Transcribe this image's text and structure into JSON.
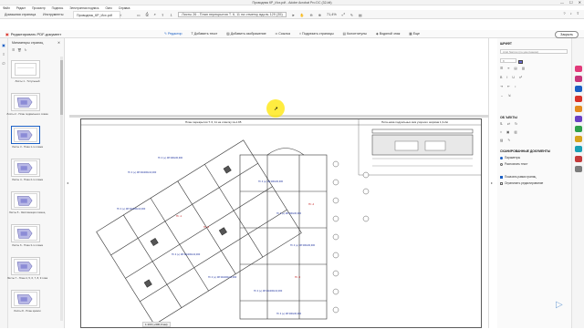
{
  "window": {
    "title": "Проводник КР_Исх.pdf - Adobe Acrobat Pro DC (32-bit)",
    "controls": [
      "—",
      "☐",
      "✕"
    ]
  },
  "menu": [
    "Файл",
    "Редакт",
    "Просмотр",
    "Подпись",
    "Электронная подпись",
    "Окно",
    "Справка"
  ],
  "tabs": [
    {
      "label": "Домашняя страница",
      "active": false
    },
    {
      "label": "Инструменты",
      "active": false
    },
    {
      "label": "Проводник_КР_Исх.pdf",
      "active": true,
      "close": "✕"
    }
  ],
  "toolbar": {
    "page_field": "Листы 26 - План перекрытия Т. 6, 11 на отметку вдоль 129 (35)",
    "zoom": "71,4%",
    "icons": [
      "save-icon",
      "print-icon",
      "search-icon",
      "zoom-out-icon",
      "zoom-in-icon",
      "select-icon",
      "hand-icon"
    ]
  },
  "editbar": {
    "label": "Редактировать PDF-документ",
    "tools": [
      {
        "label": "Редактир",
        "primary": true
      },
      {
        "label": "Добавить текст"
      },
      {
        "label": "Добавить изображение"
      },
      {
        "label": "Ссылка"
      },
      {
        "label": "Подрезать страницы"
      },
      {
        "label": "Колонтитулы"
      },
      {
        "label": "Водяной знак"
      },
      {
        "label": "Еще"
      }
    ],
    "close_label": "Закрыть"
  },
  "thumbnails": {
    "title": "Миниатюры страниц",
    "items": [
      "Листы 1 - Титульный",
      "Листы 2 - План подвального этажа",
      "Листы 3 - План 1-го этажа",
      "Листы 4 - План 2-го этажа",
      "Листы 5 - Экспликация помещ.",
      "Листы 6 - План 3-го этажа",
      "Листы 7 - План 4, 5, 6, 7, 8, 9 этаж",
      "Листы 8 - План кровли"
    ]
  },
  "drawing": {
    "left_title": "План перекрытия Т. 6, 11 на отметку Н+1.95",
    "right_title": "Пита-нова подрильных ёмк узорного ширима 1,3-2м",
    "bottom_label": "1:100 (+300,0 мм)"
  },
  "rightpanel": {
    "font_section": "ШРИФТ",
    "font_value": "Arial Narrow (по-умолчанию)",
    "size_value": "8",
    "objects_section": "ОБ ЪЕКТЫ",
    "scan_section": "СКАНИРОВАННЫЕ ДОКУМЕНТЫ",
    "scan_options": [
      {
        "label": "Параметры",
        "on": true
      },
      {
        "label": "Распознать текст",
        "on": false
      }
    ],
    "checkbox_options": [
      {
        "label": "Показать рамки границ",
        "on": true
      },
      {
        "label": "Ограничить редактирование",
        "on": false
      }
    ]
  },
  "toolrail_colors": [
    "#e23a7a",
    "#c8357a",
    "#1a5fc4",
    "#d9322a",
    "#e48a1e",
    "#6a3fc4",
    "#2fa04b",
    "#d6a21c",
    "#1aa0b5",
    "#c43a3a",
    "#7c7c7c"
  ],
  "accent": "#1a5fc4"
}
